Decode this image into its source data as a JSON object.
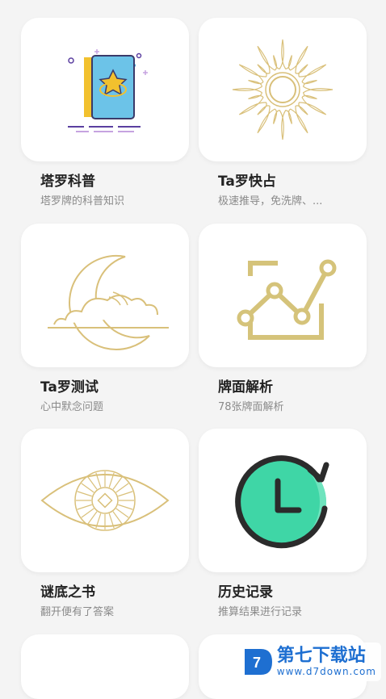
{
  "colors": {
    "gold": "#d9c07a",
    "olive_gold": "#d5c37a",
    "teal": "#3fd6a6",
    "dark": "#2b2b2b",
    "background": "#f4f4f4",
    "card": "#ffffff",
    "watermark_blue": "#1e6fd1"
  },
  "cards": [
    {
      "title": "塔罗科普",
      "subtitle": "塔罗牌的科普知识",
      "icon": "tarot-book-icon"
    },
    {
      "title": "Ta罗快占",
      "subtitle": "极速推导，免洗牌、...",
      "icon": "sun-icon"
    },
    {
      "title": "Ta罗测试",
      "subtitle": "心中默念问题",
      "icon": "moon-cloud-icon"
    },
    {
      "title": "牌面解析",
      "subtitle": "78张牌面解析",
      "icon": "line-chart-icon"
    },
    {
      "title": "谜底之书",
      "subtitle": "翻开便有了答案",
      "icon": "eye-icon"
    },
    {
      "title": "历史记录",
      "subtitle": "推算结果进行记录",
      "icon": "history-clock-icon"
    }
  ],
  "watermark": {
    "brand": "第七下载站",
    "url": "www.d7down.com"
  }
}
